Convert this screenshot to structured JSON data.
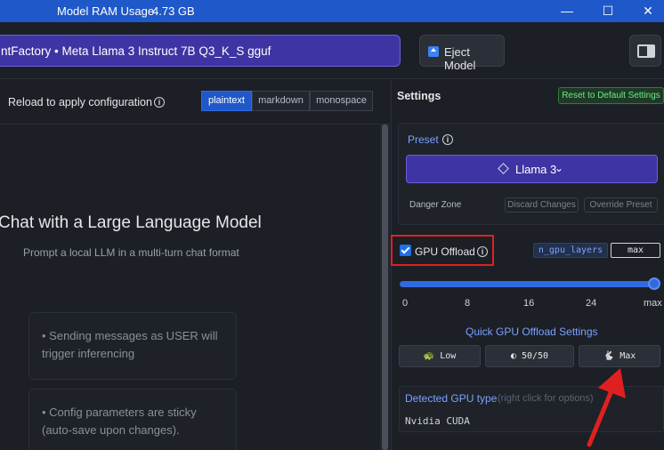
{
  "titlebar": {
    "title": "Model RAM Usage",
    "ram": "4.73 GB",
    "min": "—",
    "max": "☐",
    "close": "✕"
  },
  "topbar": {
    "model": "ntFactory • Meta Llama 3 Instruct 7B Q3_K_S gguf",
    "chevron": "⌄",
    "eject": "Eject Model"
  },
  "chat": {
    "reload": "Reload to apply configuration",
    "formats": [
      "plaintext",
      "markdown",
      "monospace"
    ],
    "welcome_title": "Chat with a Large Language Model",
    "welcome_sub": "Prompt a local LLM in a multi-turn chat format",
    "tips": [
      "• Sending messages as USER will trigger inferencing",
      "• Config parameters are sticky (auto-save upon changes)."
    ]
  },
  "settings": {
    "title": "Settings",
    "reset": "Reset to Default Settings",
    "preset_label": "Preset",
    "preset_value": "Llama 3",
    "danger_zone": "Danger Zone",
    "discard": "Discard Changes",
    "override": "Override Preset",
    "gpu_offload": "GPU Offload",
    "gpu_checked": true,
    "n_gpu_layers": "n_gpu_layers",
    "n_gpu_value": "max",
    "slider_fraction": 1.0,
    "ticks": [
      "0",
      "8",
      "16",
      "24",
      "max"
    ],
    "quick_label": "Quick GPU Offload Settings",
    "quick_buttons": [
      {
        "label": "Low",
        "icon": "🐢"
      },
      {
        "label": "50/50",
        "icon": "◐"
      },
      {
        "label": "Max",
        "icon": "🐇"
      }
    ],
    "detected_label": "Detected GPU type",
    "detected_hint": "(right click for options)",
    "detected_value": "Nvidia CUDA"
  },
  "colors": {
    "accent": "#1f58c8",
    "purple": "#3f34a3",
    "annotation_red": "#e02020"
  }
}
